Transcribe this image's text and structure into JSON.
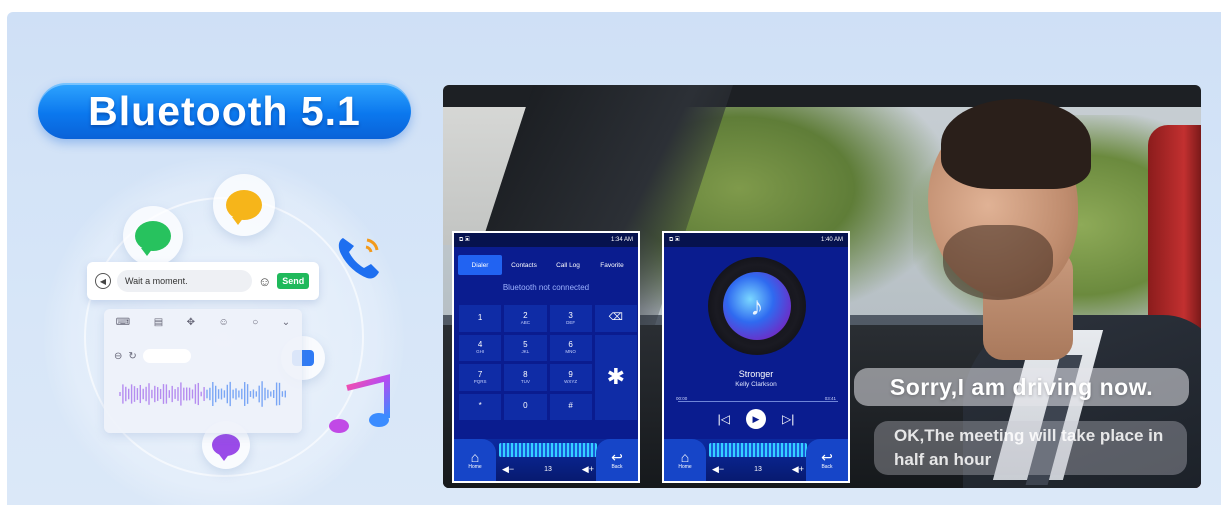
{
  "badge": {
    "title": "Bluetooth 5.1"
  },
  "chat": {
    "message": "Wait a moment.",
    "send_label": "Send",
    "voice_icon": "voice-icon",
    "emoji_icon": "emoji-icon"
  },
  "colors": {
    "badge_blue": "#0b78ee",
    "send_green": "#1fb95b",
    "screen_blue": "#0a1c8f",
    "tab_active": "#2163f2"
  },
  "dialer": {
    "status_time": "1:34 AM",
    "tabs": [
      "Dialer",
      "Contacts",
      "Call Log",
      "Favorite"
    ],
    "active_tab": "Dialer",
    "bt_status": "Bluetooth not connected",
    "keys": [
      {
        "digit": "1",
        "letters": ""
      },
      {
        "digit": "2",
        "letters": "ABC"
      },
      {
        "digit": "3",
        "letters": "DEF"
      },
      {
        "digit": "4",
        "letters": "GHI"
      },
      {
        "digit": "5",
        "letters": "JKL"
      },
      {
        "digit": "6",
        "letters": "MNO"
      },
      {
        "digit": "7",
        "letters": "PQRS"
      },
      {
        "digit": "8",
        "letters": "TUV"
      },
      {
        "digit": "9",
        "letters": "WXYZ"
      },
      {
        "digit": "*",
        "letters": ""
      },
      {
        "digit": "0",
        "letters": ""
      },
      {
        "digit": "#",
        "letters": ""
      }
    ],
    "volume": "13",
    "home_label": "Home",
    "back_label": "Back"
  },
  "player": {
    "status_time": "1:40 AM",
    "song": "Stronger",
    "artist": "Kelly Clarkson",
    "time_start": "00:00",
    "time_end": "03:41",
    "volume": "13",
    "home_label": "Home",
    "back_label": "Back"
  },
  "messages": {
    "driving": "Sorry,I am driving now.",
    "meeting": "OK,The meeting will take place in half an hour"
  }
}
